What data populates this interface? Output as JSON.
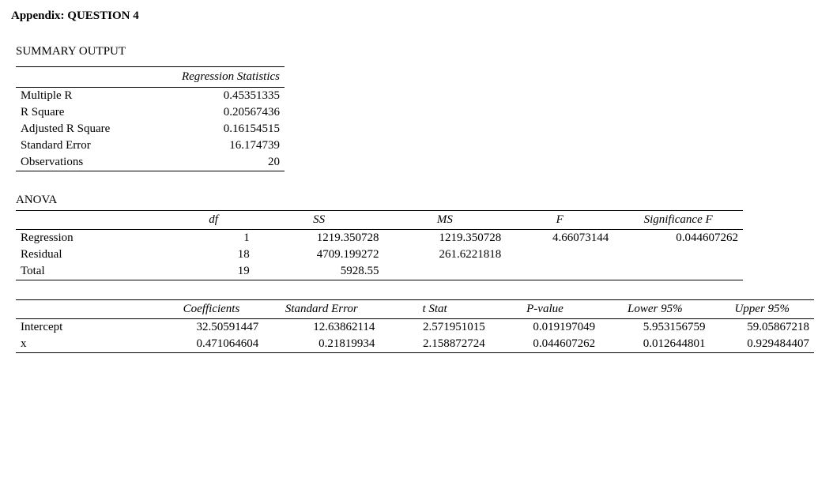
{
  "title": "Appendix: QUESTION 4",
  "summary_heading": "SUMMARY OUTPUT",
  "regstats": {
    "header": "Regression Statistics",
    "rows": [
      {
        "label": "Multiple R",
        "value": "0.45351335"
      },
      {
        "label": "R Square",
        "value": "0.20567436"
      },
      {
        "label": "Adjusted R Square",
        "value": "0.16154515"
      },
      {
        "label": "Standard Error",
        "value": "16.174739"
      },
      {
        "label": "Observations",
        "value": "20"
      }
    ]
  },
  "anova": {
    "title": "ANOVA",
    "headers": [
      "",
      "df",
      "SS",
      "MS",
      "F",
      "Significance F"
    ],
    "rows": [
      {
        "label": "Regression",
        "df": "1",
        "ss": "1219.350728",
        "ms": "1219.350728",
        "f": "4.66073144",
        "sig": "0.044607262"
      },
      {
        "label": "Residual",
        "df": "18",
        "ss": "4709.199272",
        "ms": "261.6221818",
        "f": "",
        "sig": ""
      },
      {
        "label": "Total",
        "df": "19",
        "ss": "5928.55",
        "ms": "",
        "f": "",
        "sig": ""
      }
    ]
  },
  "coef": {
    "headers": [
      "",
      "Coefficients",
      "Standard Error",
      "t Stat",
      "P-value",
      "Lower 95%",
      "Upper 95%"
    ],
    "rows": [
      {
        "label": "Intercept",
        "coef": "32.50591447",
        "se": "12.63862114",
        "t": "2.571951015",
        "p": "0.019197049",
        "lo": "5.953156759",
        "hi": "59.05867218"
      },
      {
        "label": "x",
        "coef": "0.471064604",
        "se": "0.21819934",
        "t": "2.158872724",
        "p": "0.044607262",
        "lo": "0.012644801",
        "hi": "0.929484407"
      }
    ]
  },
  "chart_data": {
    "type": "table",
    "title": "Regression Summary Output — Question 4",
    "regression_statistics": {
      "Multiple R": 0.45351335,
      "R Square": 0.20567436,
      "Adjusted R Square": 0.16154515,
      "Standard Error": 16.174739,
      "Observations": 20
    },
    "anova": [
      {
        "source": "Regression",
        "df": 1,
        "SS": 1219.350728,
        "MS": 1219.350728,
        "F": 4.66073144,
        "Significance F": 0.044607262
      },
      {
        "source": "Residual",
        "df": 18,
        "SS": 4709.199272,
        "MS": 261.6221818
      },
      {
        "source": "Total",
        "df": 19,
        "SS": 5928.55
      }
    ],
    "coefficients": [
      {
        "term": "Intercept",
        "Coefficients": 32.50591447,
        "Standard Error": 12.63862114,
        "t Stat": 2.571951015,
        "P-value": 0.019197049,
        "Lower 95%": 5.953156759,
        "Upper 95%": 59.05867218
      },
      {
        "term": "x",
        "Coefficients": 0.471064604,
        "Standard Error": 0.21819934,
        "t Stat": 2.158872724,
        "P-value": 0.044607262,
        "Lower 95%": 0.012644801,
        "Upper 95%": 0.929484407
      }
    ]
  }
}
